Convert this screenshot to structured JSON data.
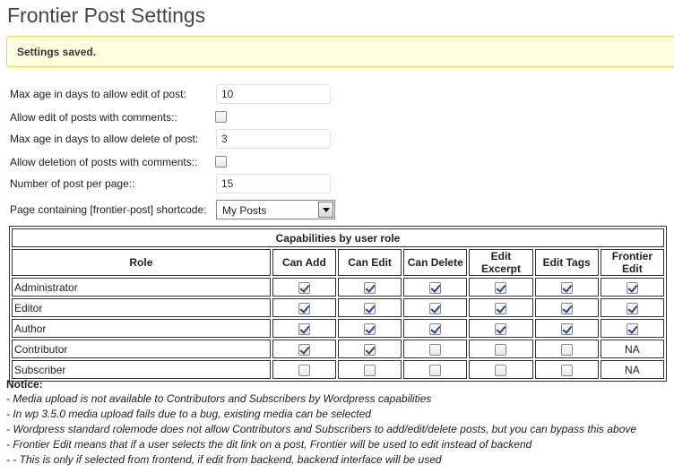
{
  "page": {
    "title": "Frontier Post Settings"
  },
  "notice": {
    "message": "Settings saved."
  },
  "settings": {
    "max_age_edit": {
      "label": "Max age in days to allow edit of post:",
      "value": "10"
    },
    "allow_edit_comments": {
      "label": "Allow edit of posts with comments::",
      "checked": false
    },
    "max_age_delete": {
      "label": "Max age in days to allow delete of post:",
      "value": "3"
    },
    "allow_delete_comments": {
      "label": "Allow deletion of posts with comments::",
      "checked": false
    },
    "posts_per_page": {
      "label": "Number of post per page::",
      "value": "15"
    },
    "shortcode_page": {
      "label": "Page containing [frontier-post] shortcode:",
      "value": "My Posts"
    }
  },
  "capabilities": {
    "caption": "Capabilities by user role",
    "columns": [
      "Role",
      "Can Add",
      "Can Edit",
      "Can Delete",
      "Edit Excerpt",
      "Edit Tags",
      "Frontier Edit"
    ],
    "rows": [
      {
        "role": "Administrator",
        "values": [
          true,
          true,
          true,
          true,
          true,
          true
        ]
      },
      {
        "role": "Editor",
        "values": [
          true,
          true,
          true,
          true,
          true,
          true
        ]
      },
      {
        "role": "Author",
        "values": [
          true,
          true,
          true,
          true,
          true,
          true
        ]
      },
      {
        "role": "Contributor",
        "values": [
          true,
          true,
          false,
          false,
          false,
          "NA"
        ]
      },
      {
        "role": "Subscriber",
        "values": [
          false,
          false,
          false,
          false,
          false,
          "NA"
        ]
      }
    ]
  },
  "notices": {
    "heading": "Notice:",
    "lines": [
      "- Media upload is not available to Contributors and Subscribers by Wordpress capabilities",
      "- In wp 3.5.0 media upload fails due to a bug, existing media can be selected",
      "- Wordpress standard rolemode does not allow Contributors and Subscribers to add/edit/delete posts, but you can bypass this above",
      "- Frontier Edit means that if a user selects the dit link on a post, Frontier will be used to edit instead of backend",
      "- - This is only if selected from frontend, if edit from backend, backend interface will be used"
    ]
  }
}
